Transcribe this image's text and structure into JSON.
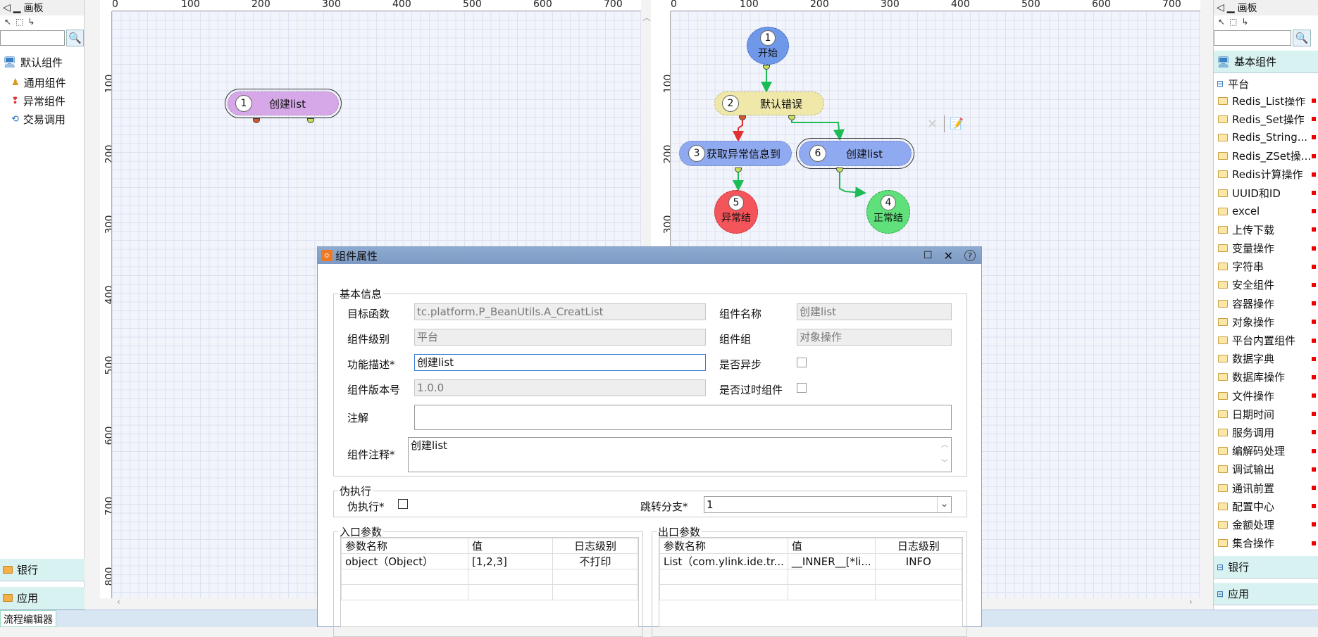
{
  "left_palette": {
    "title": "画板",
    "root": "默认组件",
    "items": [
      "通用组件",
      "异常组件",
      "交易调用"
    ],
    "bottom": [
      "银行",
      "应用"
    ]
  },
  "right_palette": {
    "title": "画板",
    "category": "基本组件",
    "group": "平台",
    "items": [
      "Redis_List操作",
      "Redis_Set操作",
      "Redis_String...",
      "Redis_ZSet操...",
      "Redis计算操作",
      "UUID和ID",
      "excel",
      "上传下载",
      "变量操作",
      "字符串",
      "安全组件",
      "容器操作",
      "对象操作",
      "平台内置组件",
      "数据字典",
      "数据库操作",
      "文件操作",
      "日期时间",
      "服务调用",
      "编解码处理",
      "调试输出",
      "通讯前置",
      "配置中心",
      "金额处理",
      "集合操作"
    ],
    "bottom": [
      "银行",
      "应用"
    ]
  },
  "ruler": {
    "h_labels": [
      "0",
      "100",
      "200",
      "300",
      "400",
      "500",
      "600",
      "700"
    ],
    "v_labels": [
      "100",
      "200",
      "300",
      "400",
      "500",
      "600",
      "700",
      "800"
    ],
    "v_labels_right": [
      "100",
      "200",
      "300"
    ]
  },
  "left_canvas": {
    "node": {
      "num": "1",
      "label": "创建list"
    }
  },
  "right_canvas": {
    "nodes": [
      {
        "num": "1",
        "label": "开始"
      },
      {
        "num": "2",
        "label": "默认错误"
      },
      {
        "num": "3",
        "label": "获取异常信息到"
      },
      {
        "num": "6",
        "label": "创建list"
      },
      {
        "num": "5",
        "label": "异常结"
      },
      {
        "num": "4",
        "label": "正常结"
      }
    ]
  },
  "dialog": {
    "title": "组件属性",
    "basic_legend": "基本信息",
    "target_fn_label": "目标函数",
    "target_fn_value": "tc.platform.P_BeanUtils.A_CreatList",
    "comp_name_label": "组件名称",
    "comp_name_value": "创建list",
    "level_label": "组件级别",
    "level_value": "平台",
    "group_label": "组件组",
    "group_value": "对象操作",
    "desc_label": "功能描述*",
    "desc_value": "创建list",
    "async_label": "是否异步",
    "version_label": "组件版本号",
    "version_value": "1.0.0",
    "deprecated_label": "是否过时组件",
    "note_label": "注解",
    "note_value": "",
    "comment_label": "组件注释*",
    "comment_value": "创建list",
    "fake_legend": "伪执行",
    "fake_label": "伪执行*",
    "branch_label": "跳转分支*",
    "branch_value": "1",
    "in_legend": "入口参数",
    "out_legend": "出口参数",
    "in_headers": [
      "参数名称",
      "值",
      "日志级别"
    ],
    "in_rows": [
      [
        "object（Object）",
        "[1,2,3]",
        "不打印"
      ]
    ],
    "out_headers": [
      "参数名称",
      "值",
      "日志级别"
    ],
    "out_rows": [
      [
        "List（com.ylink.ide.tr...",
        "__INNER__[*li...",
        "INFO"
      ]
    ]
  },
  "status_tab": "流程编辑器",
  "colors": {
    "accent": "#7d9ac4",
    "node_purple": "#d6a8e8",
    "node_yellow": "#efe8a8",
    "node_blue": "#8faaf0",
    "node_red": "#f4555a",
    "node_green": "#5fe07a"
  }
}
